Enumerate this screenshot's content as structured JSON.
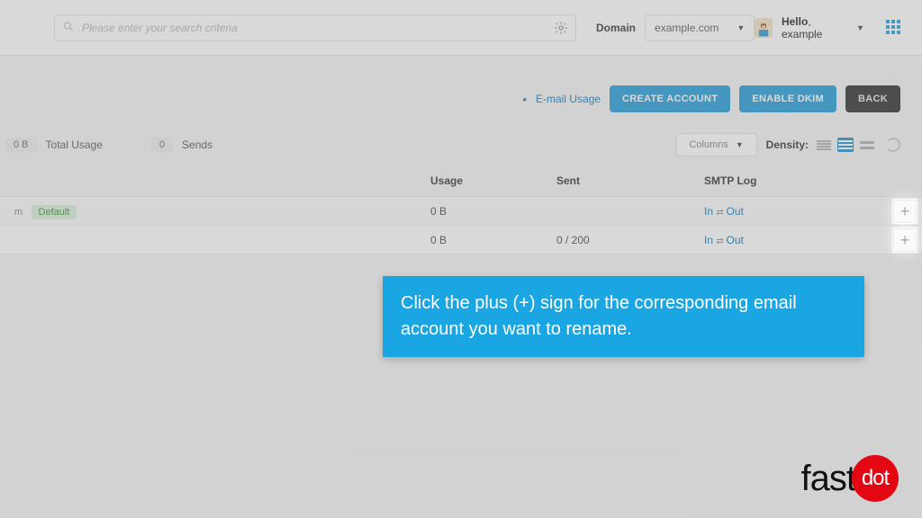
{
  "header": {
    "search_placeholder": "Please enter your search criteria",
    "domain_label": "Domain",
    "domain_value": "example.com",
    "hello_prefix": "Hello",
    "hello_user": "example"
  },
  "actions": {
    "email_usage_link": "E-mail Usage",
    "create_account": "CREATE ACCOUNT",
    "enable_dkim": "ENABLE DKIM",
    "back": "BACK"
  },
  "toolbar": {
    "total_usage_value": "0 B",
    "total_usage_label": "Total Usage",
    "sends_value": "0",
    "sends_label": "Sends",
    "columns_label": "Columns",
    "density_label": "Density:"
  },
  "columns": {
    "usage": "Usage",
    "sent": "Sent",
    "smtp": "SMTP Log"
  },
  "rows": [
    {
      "account_suffix": "m",
      "default_badge": "Default",
      "usage": "0 B",
      "sent": "",
      "smtp_in": "In",
      "smtp_out": "Out"
    },
    {
      "account_suffix": "",
      "default_badge": "",
      "usage": "0 B",
      "sent": "0 / 200",
      "smtp_in": "In",
      "smtp_out": "Out"
    }
  ],
  "callout": "Click the plus (+) sign for the corresponding email account you want to rename.",
  "logo": {
    "text": "fast",
    "dot": "dot"
  }
}
